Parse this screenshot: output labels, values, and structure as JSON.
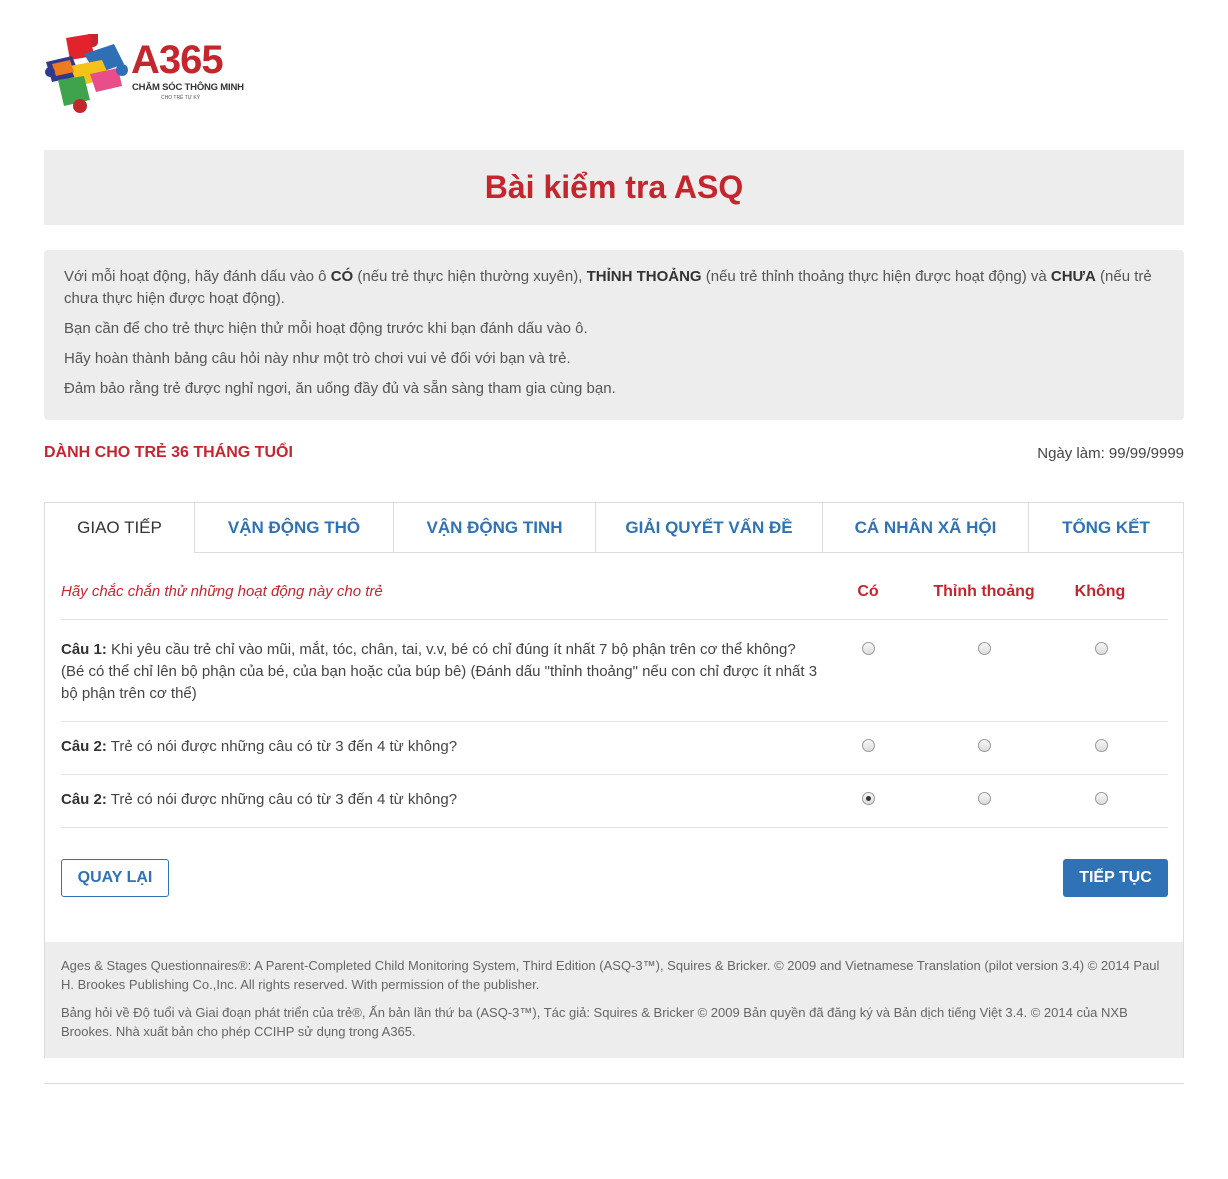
{
  "brand": {
    "name": "A365",
    "tagline": "CHĂM SÓC THÔNG MINH",
    "subline": "CHO TRẺ TỰ KỶ"
  },
  "page_title": "Bài kiểm tra ASQ",
  "instructions": {
    "p1_a": "Với mỗi hoạt động, hãy đánh dấu vào ô ",
    "p1_b": "CÓ",
    "p1_c": " (nếu trẻ thực hiện thường xuyên), ",
    "p1_d": "THỈNH THOẢNG",
    "p1_e": " (nếu trẻ thỉnh thoảng thực hiện được hoạt động) và ",
    "p1_f": "CHƯA",
    "p1_g": " (nếu trẻ chưa thực hiện được hoạt động).",
    "p2": "Bạn cần để cho trẻ thực hiện thử mỗi hoạt động trước khi bạn đánh dấu vào ô.",
    "p3": "Hãy hoàn thành bảng câu hỏi này như một trò chơi vui vẻ đối với bạn và trẻ.",
    "p4": "Đảm bảo rằng trẻ được nghỉ ngơi, ăn uống đầy đủ và sẵn sàng tham gia cùng bạn."
  },
  "age_label": "DÀNH CHO TRẺ 36 THÁNG TUỔI",
  "date_label": "Ngày làm: 99/99/9999",
  "tabs": [
    {
      "label": "GIAO TIẾP",
      "active": true
    },
    {
      "label": "VẬN ĐỘNG THÔ",
      "active": false
    },
    {
      "label": "VẬN ĐỘNG TINH",
      "active": false
    },
    {
      "label": "GIẢI QUYẾT VẤN ĐỀ",
      "active": false
    },
    {
      "label": "CÁ NHÂN XÃ HỘI",
      "active": false
    },
    {
      "label": "TỔNG KẾT",
      "active": false
    }
  ],
  "hint": "Hãy chắc chắn thử những hoạt động này cho trẻ",
  "columns": {
    "yes": "Có",
    "sometimes": "Thỉnh thoảng",
    "no": "Không"
  },
  "questions": [
    {
      "label": "Câu 1:",
      "text": " Khi yêu cầu trẻ chỉ vào mũi, mắt, tóc, chân, tai, v.v, bé có chỉ đúng ít nhất 7 bộ phận trên cơ thể không? (Bé có thể chỉ lên bộ phận của bé, của bạn hoặc của búp bê) (Đánh dấu \"thỉnh thoảng\" nếu con chỉ được ít nhất 3 bộ phận trên cơ thể)",
      "selected": null
    },
    {
      "label": "Câu 2:",
      "text": " Trẻ có nói được những câu có từ 3 đến 4 từ không?",
      "selected": null
    },
    {
      "label": "Câu 2:",
      "text": " Trẻ có nói được những câu có từ 3 đến 4 từ không?",
      "selected": "yes"
    }
  ],
  "buttons": {
    "back": "QUAY LẠI",
    "next": "TIẾP TỤC"
  },
  "footer": {
    "en": "Ages & Stages Questionnaires®: A Parent-Completed Child Monitoring System, Third Edition (ASQ-3™), Squires & Bricker. © 2009 and Vietnamese Translation (pilot version 3.4) © 2014 Paul H. Brookes Publishing Co.,Inc. All rights reserved. With permission of the publisher.",
    "vi": "Bảng hỏi về Độ tuổi và Giai đoạn phát triển của trẻ®, Ấn bản lần thứ ba (ASQ-3™), Tác giả: Squires & Bricker © 2009 Bản quyền đã đăng ký và Bản dịch tiếng Việt 3.4. © 2014 của NXB Brookes. Nhà xuất bản cho phép CCIHP sử dụng trong A365."
  },
  "colors": {
    "brand_red": "#c4262e",
    "link_blue": "#2f73b6",
    "panel_gray": "#ededed"
  }
}
